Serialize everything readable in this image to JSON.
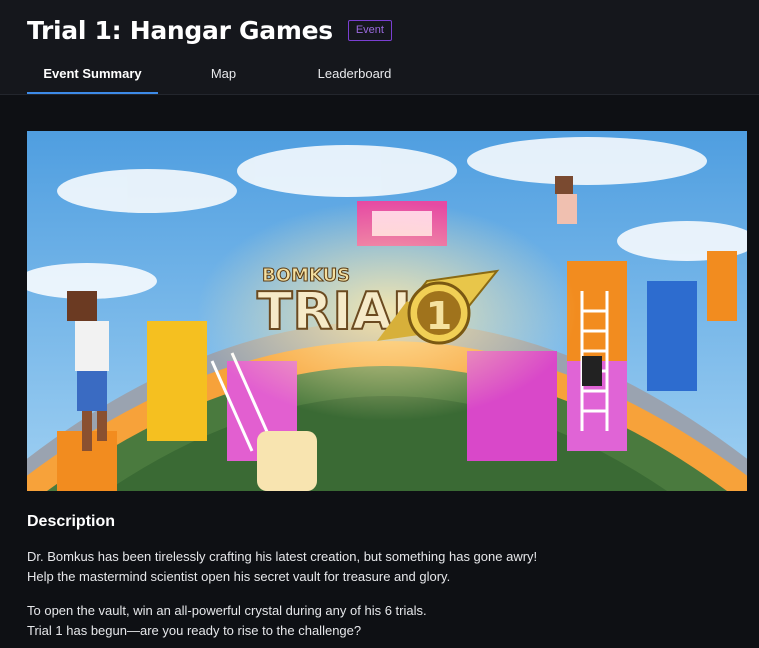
{
  "page": {
    "title": "Trial 1: Hangar Games",
    "badge": "Event"
  },
  "tabs": [
    {
      "label": "Event Summary",
      "active": true
    },
    {
      "label": "Map",
      "active": false
    },
    {
      "label": "Leaderboard",
      "active": false
    }
  ],
  "hero": {
    "logo_text": "BOMKUS",
    "banner_text": "TRIAL",
    "banner_number": "1"
  },
  "description": {
    "heading": "Description",
    "lines": [
      "Dr. Bomkus has been tirelessly crafting his latest creation, but something has gone awry!",
      "Help the mastermind scientist open his secret vault for treasure and glory.",
      "To open the vault, win an all-powerful crystal during any of his 6 trials.",
      "Trial 1 has begun—are you ready to rise to the challenge?"
    ]
  },
  "colors": {
    "background": "#0e1014",
    "header": "#15171c",
    "accent_tab": "#3d8be8",
    "badge": "#7a3fd1"
  }
}
